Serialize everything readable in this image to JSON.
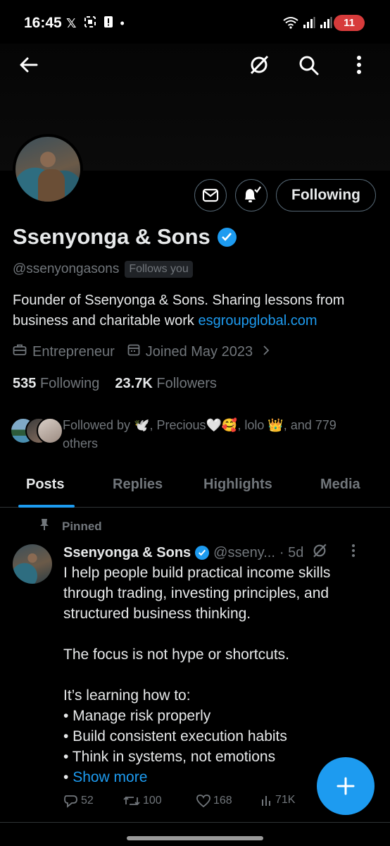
{
  "status_bar": {
    "time": "16:45",
    "battery": "11",
    "icons": [
      "x-logo-icon",
      "screenshot-icon",
      "alert-icon",
      "dot-icon",
      "wifi-icon",
      "signal-icon",
      "signal-icon"
    ]
  },
  "header": {
    "icons": [
      "back-arrow-icon",
      "grok-icon",
      "search-icon",
      "more-vertical-icon"
    ]
  },
  "profile": {
    "name": "Ssenyonga & Sons",
    "handle": "@ssenyongasons",
    "follows_you": "Follows you",
    "bio_text": "Founder of Ssenyonga & Sons. Sharing lessons from business and charitable work ",
    "bio_link": "esgroupglobal.com",
    "category": "Entrepreneur",
    "joined": "Joined May 2023",
    "following_count": "535",
    "following_label": "Following",
    "followers_count": "23.7K",
    "followers_label": "Followers",
    "followed_by": "Followed by 🕊️, Precious🤍🥰, lolo 👑, and 779 others",
    "follow_button": "Following"
  },
  "tabs": [
    {
      "label": "Posts",
      "active": true
    },
    {
      "label": "Replies",
      "active": false
    },
    {
      "label": "Highlights",
      "active": false
    },
    {
      "label": "Media",
      "active": false
    }
  ],
  "post": {
    "pinned_label": "Pinned",
    "author": "Ssenyonga & Sons",
    "handle": "@sseny...",
    "time": "· 5d",
    "paragraph1": "I help people build practical income skills through trading, investing principles, and structured business thinking.",
    "paragraph2": "The focus is not hype or shortcuts.",
    "paragraph3": "It’s learning how to:",
    "bullet1": "• Manage risk properly",
    "bullet2": "• Build consistent execution habits",
    "bullet3": "• Think in systems, not emotions",
    "bullet4_prefix": "• ",
    "show_more": "Show more",
    "replies": "52",
    "reposts": "100",
    "likes": "168",
    "views": "71K"
  },
  "colors": {
    "accent": "#1d9bf0",
    "muted": "#71767b",
    "background": "#000000",
    "text": "#e7e9ea"
  }
}
